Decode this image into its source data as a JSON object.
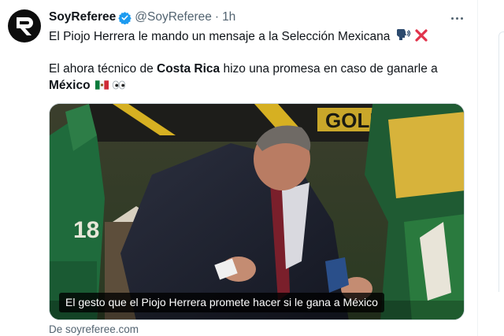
{
  "tweet": {
    "author": {
      "name": "SoyReferee",
      "handle": "@SoyReferee",
      "separator": "·",
      "time": "1h",
      "avatar_icon": "soyreferee-logo-icon",
      "verified_icon": "verified-badge-icon"
    },
    "line1": "El Piojo Herrera le mando un mensaje a la Selección Mexicana",
    "line1_emoji": [
      "speaking-head-icon",
      "red-x-icon"
    ],
    "line2_pre": "El ahora técnico de ",
    "line2_bold": "Costa Rica",
    "line2_post": " hizo una promesa en caso de ganarle a",
    "line3_bold": "México",
    "line3_emoji": [
      "mexico-flag-icon",
      "eyes-icon"
    ],
    "media_caption": "El gesto que el Piojo Herrera promete hacer si le gana a México",
    "media_source": "De soyreferee.com",
    "more_icon": "more-options-icon",
    "colors": {
      "text": "#0f1419",
      "secondary": "#536471",
      "verified": "#1d9bf0",
      "emoji_red": "#e1324b"
    }
  }
}
